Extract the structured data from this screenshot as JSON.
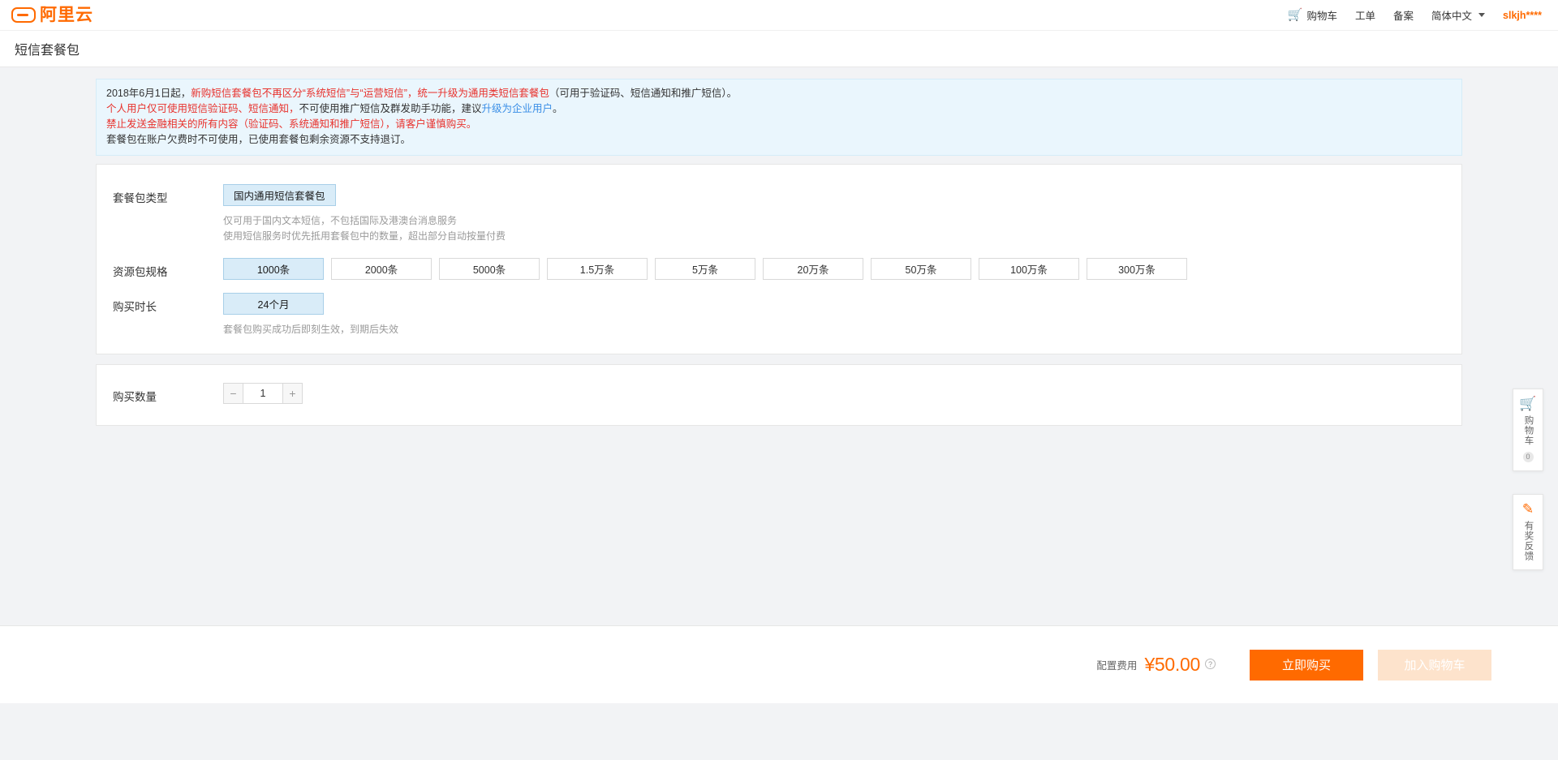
{
  "header": {
    "logo_text": "阿里云",
    "nav": [
      {
        "label": "购物车",
        "icon": "cart-icon"
      },
      {
        "label": "工单"
      },
      {
        "label": "备案"
      },
      {
        "label": "简体中文",
        "icon": "chevron-down-icon"
      }
    ],
    "user": "slkjh****"
  },
  "page": {
    "title": "短信套餐包"
  },
  "notice": {
    "line1_a": "2018年6月1日起，",
    "line1_b": "新购短信套餐包不再区分“系统短信”与“运营短信”，统一升级为通用类短信套餐包",
    "line1_c": "（可用于验证码、短信通知和推广短信）。",
    "line2_a": "个人用户仅可使用短信验证码、短信通知，",
    "line2_b": "不可使用推广短信及群发助手功能，建议",
    "line2_link": "升级为企业用户",
    "line2_c": "。",
    "line3": "禁止发送金融相关的所有内容（验证码、系统通知和推广短信），请客户谨慎购买。",
    "line4": "套餐包在账户欠费时不可使用，已使用套餐包剩余资源不支持退订。"
  },
  "form": {
    "type": {
      "label": "套餐包类型",
      "options": [
        "国内通用短信套餐包"
      ],
      "selected": "国内通用短信套餐包",
      "hint1": "仅可用于国内文本短信，不包括国际及港澳台消息服务",
      "hint2": "使用短信服务时优先抵用套餐包中的数量，超出部分自动按量付费"
    },
    "spec": {
      "label": "资源包规格",
      "options": [
        "1000条",
        "2000条",
        "5000条",
        "1.5万条",
        "5万条",
        "20万条",
        "50万条",
        "100万条",
        "300万条"
      ],
      "selected": "1000条"
    },
    "duration": {
      "label": "购买时长",
      "options": [
        "24个月"
      ],
      "selected": "24个月",
      "hint": "套餐包购买成功后即刻生效，到期后失效"
    },
    "quantity": {
      "label": "购买数量",
      "value": "1",
      "minus": "−",
      "plus": "+"
    }
  },
  "float_panels": {
    "cart": {
      "label": "购物车",
      "icon": "cart-icon",
      "count": "0"
    },
    "feedback": {
      "label": "有奖反馈",
      "icon": "pencil-icon"
    }
  },
  "bottom": {
    "fee_label": "配置费用",
    "fee_amount": "¥50.00",
    "help_icon": "question-icon",
    "buy_label": "立即购买",
    "add_cart_label": "加入购物车"
  },
  "colors": {
    "brand_orange": "#ff6a00",
    "notice_bg": "#eaf6fd",
    "selected_bg": "#d9ecf8",
    "red_text": "#e8322d",
    "link_blue": "#3a8ee6"
  }
}
